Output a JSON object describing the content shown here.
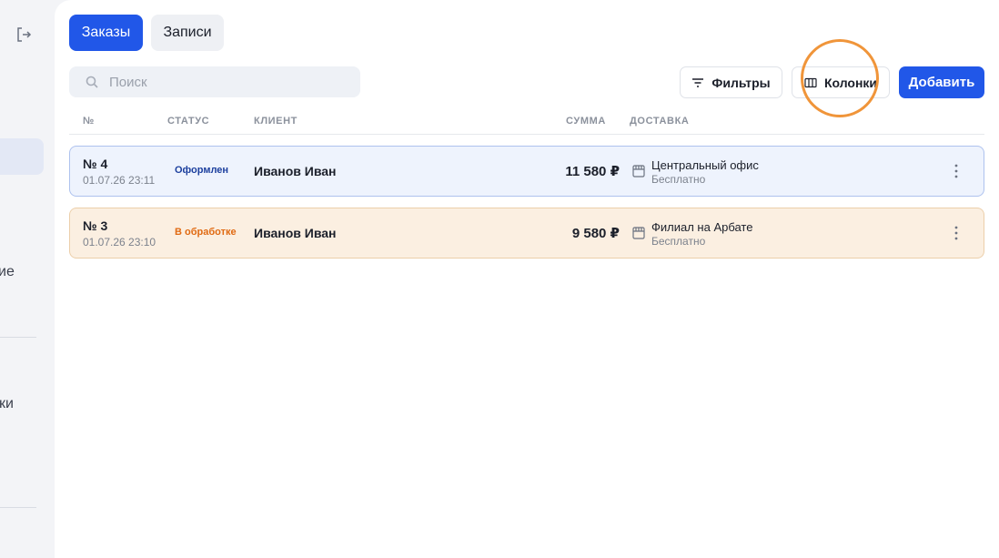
{
  "sidebar": {
    "text_1": "ие",
    "text_2": "ики",
    "active_glyph": "ı"
  },
  "tabs": [
    {
      "label": "Заказы",
      "active": true
    },
    {
      "label": "Записи",
      "active": false
    }
  ],
  "search": {
    "placeholder": "Поиск",
    "value": ""
  },
  "toolbar": {
    "filters_label": "Фильтры",
    "columns_label": "Колонки",
    "add_label": "Добавить"
  },
  "table": {
    "headers": [
      "№",
      "СТАТУС",
      "КЛИЕНТ",
      "СУММА",
      "ДОСТАВКА"
    ],
    "rows": [
      {
        "number": "№ 4",
        "datetime": "01.07.26 23:11",
        "status": "Оформлен",
        "client": "Иванов Иван",
        "sum": "11 580 ₽",
        "delivery_name": "Центральный офис",
        "delivery_price": "Бесплатно"
      },
      {
        "number": "№ 3",
        "datetime": "01.07.26 23:10",
        "status": "В обработке",
        "client": "Иванов Иван",
        "sum": "9 580 ₽",
        "delivery_name": "Филиал на Арбате",
        "delivery_price": "Бесплатно"
      }
    ]
  },
  "colors": {
    "accent": "#2157e8",
    "status_blue": "#1c3f9e",
    "status_orange": "#e06a12",
    "highlight_ring": "#f0953a"
  }
}
